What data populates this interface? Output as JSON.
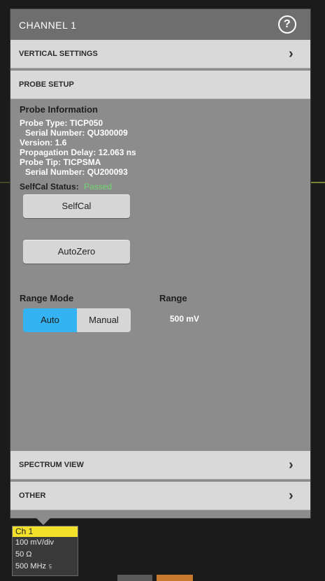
{
  "panel": {
    "title": "CHANNEL 1",
    "help_icon": "question-circle-icon"
  },
  "sections": {
    "vertical_settings": "VERTICAL SETTINGS",
    "probe_setup": "PROBE SETUP",
    "spectrum_view": "SPECTRUM VIEW",
    "other": "OTHER"
  },
  "probe_info": {
    "title": "Probe Information",
    "lines": [
      "Probe Type: TICP050",
      "  Serial Number: QU300009",
      "Version: 1.6",
      "Propagation Delay: 12.063 ns",
      "Probe Tip: TICPSMA",
      "  Serial Number: QU200093"
    ],
    "selfcal_label": "SelfCal Status:",
    "selfcal_value": "Passed"
  },
  "buttons": {
    "selfcal": "SelfCal",
    "autozero": "AutoZero"
  },
  "range": {
    "mode_label": "Range Mode",
    "mode_options": [
      "Auto",
      "Manual"
    ],
    "selected_mode": "Auto",
    "range_label": "Range",
    "range_value": "500 mV"
  },
  "channel_badge": {
    "name": "Ch 1",
    "scale": "100 mV/div",
    "termination": "50 Ω",
    "bandwidth": "500 MHz"
  },
  "colors": {
    "channel_yellow": "#f2e02a",
    "selected_blue": "#33b3f2",
    "status_green": "#6fd66f"
  }
}
